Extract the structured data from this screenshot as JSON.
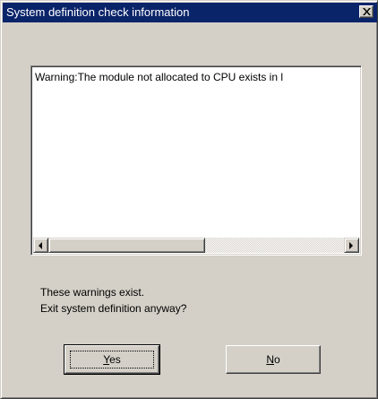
{
  "window": {
    "title": "System definition check information"
  },
  "list": {
    "items": [
      "Warning:The module not allocated to CPU exists in l"
    ]
  },
  "message": {
    "line1": "These warnings exist.",
    "line2": "Exit system definition anyway?"
  },
  "buttons": {
    "yes": {
      "mnemonic": "Y",
      "rest": "es"
    },
    "no": {
      "mnemonic": "N",
      "rest": "o"
    }
  },
  "icons": {
    "close": "close-icon",
    "scroll_left": "arrow-left-icon",
    "scroll_right": "arrow-right-icon"
  },
  "colors": {
    "titlebar": "#0a246a",
    "face": "#d4d0c8"
  }
}
